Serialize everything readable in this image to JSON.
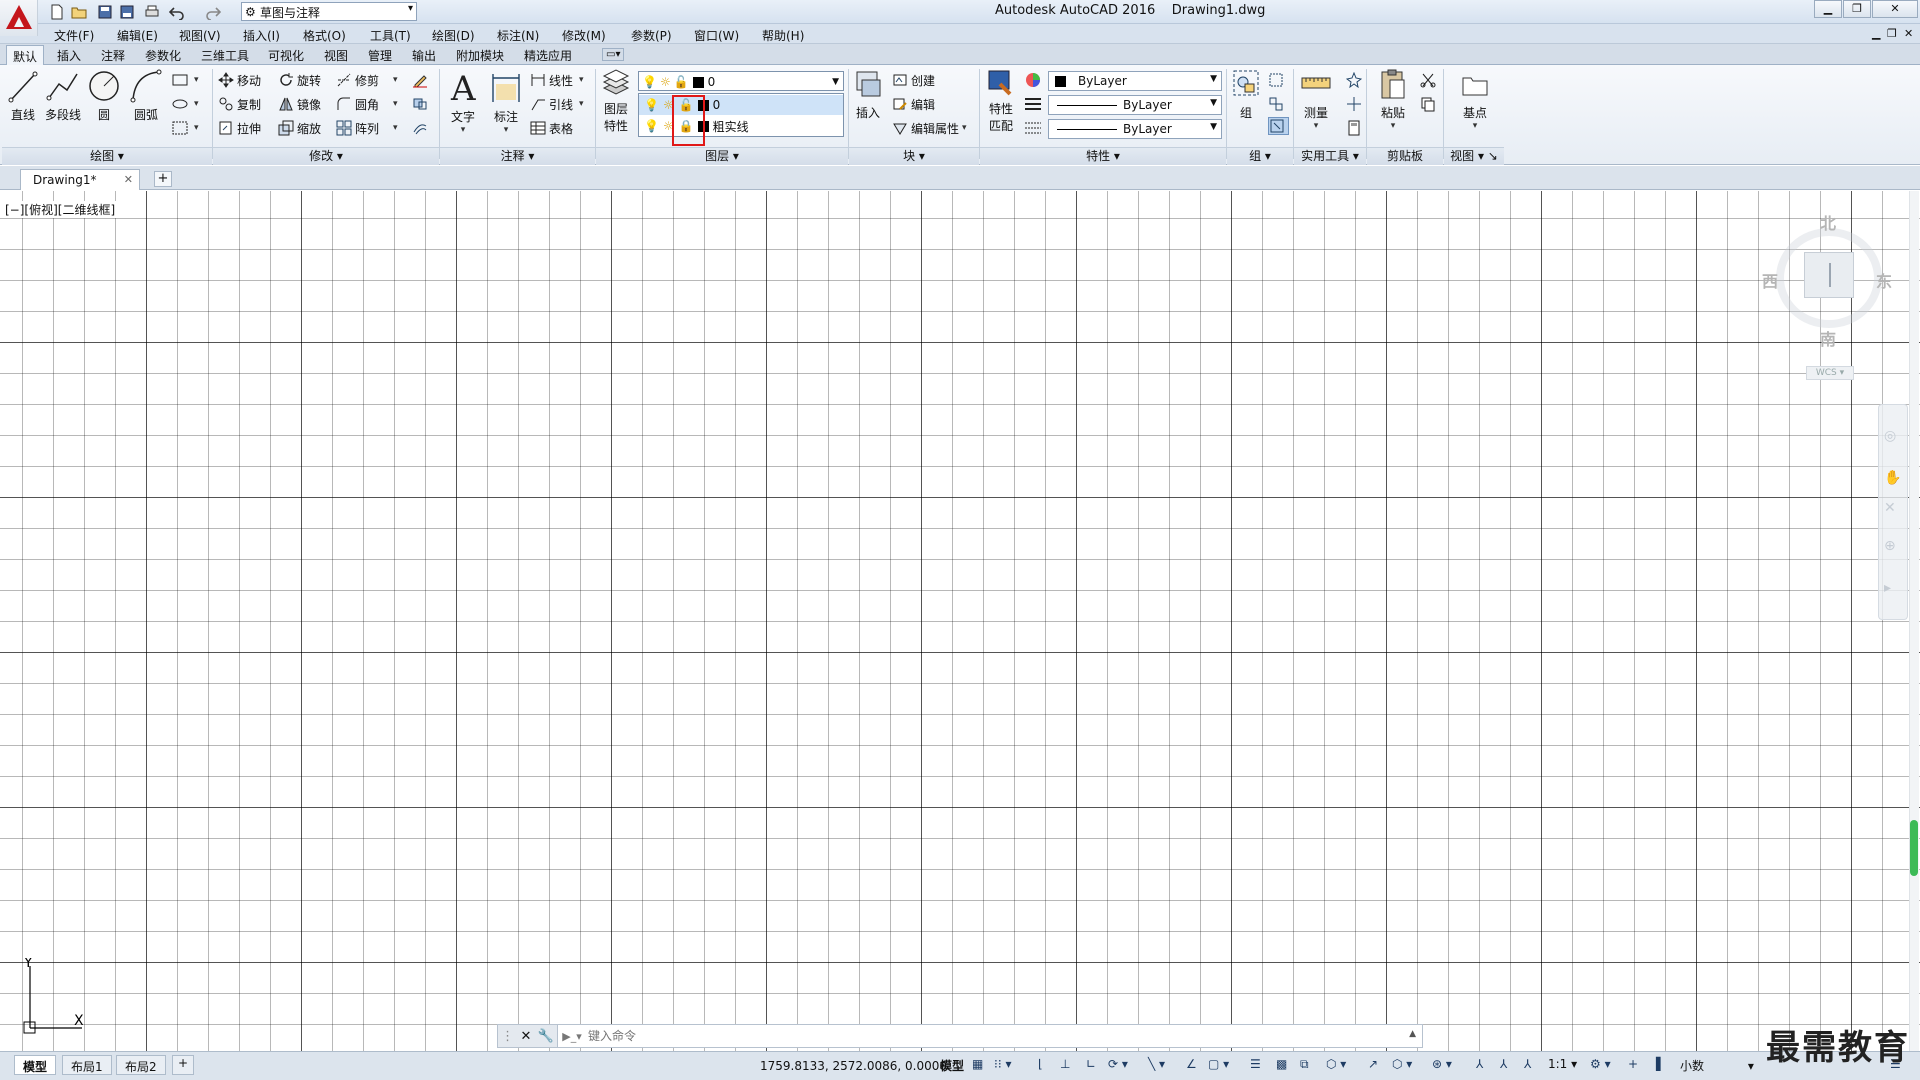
{
  "titlebar": {
    "title": "Autodesk AutoCAD 2016",
    "document": "Drawing1.dwg",
    "workspace": "草图与注释"
  },
  "menu": [
    "文件(F)",
    "编辑(E)",
    "视图(V)",
    "插入(I)",
    "格式(O)",
    "工具(T)",
    "绘图(D)",
    "标注(N)",
    "修改(M)",
    "参数(P)",
    "窗口(W)",
    "帮助(H)"
  ],
  "ribbon_tabs": [
    "默认",
    "插入",
    "注释",
    "参数化",
    "三维工具",
    "可视化",
    "视图",
    "管理",
    "输出",
    "附加模块",
    "精选应用"
  ],
  "ribbon": {
    "draw": {
      "title": "绘图",
      "line": "直线",
      "polyline": "多段线",
      "circle": "圆",
      "arc": "圆弧"
    },
    "modify": {
      "title": "修改",
      "move": "移动",
      "rotate": "旋转",
      "trim": "修剪",
      "copy": "复制",
      "mirror": "镜像",
      "fillet": "圆角",
      "stretch": "拉伸",
      "scale": "缩放",
      "array": "阵列"
    },
    "annotation": {
      "title": "注释",
      "text": "文字",
      "dimension": "标注",
      "linear": "线性",
      "leader": "引线",
      "table": "表格"
    },
    "layers": {
      "title": "图层",
      "properties_line1": "图层",
      "properties_line2": "特性",
      "current": "0",
      "list": [
        {
          "name": "0",
          "locked": false
        },
        {
          "name": "粗实线",
          "locked": true
        }
      ]
    },
    "block": {
      "title": "块",
      "insert": "插入",
      "create": "创建",
      "edit": "编辑",
      "edit_attr": "编辑属性"
    },
    "properties": {
      "title": "特性",
      "match_line1": "特性",
      "match_line2": "匹配",
      "color": "ByLayer",
      "linetype": "ByLayer",
      "lineweight": "ByLayer"
    },
    "groups": {
      "title": "组",
      "group": "组"
    },
    "utilities": {
      "title": "实用工具",
      "measure": "测量"
    },
    "clipboard": {
      "title": "剪贴板",
      "paste": "粘贴"
    },
    "view": {
      "title": "视图",
      "base": "基点"
    }
  },
  "file_tab": {
    "name": "Drawing1*"
  },
  "viewport_label": "[−][俯视][二维线框]",
  "viewcube": {
    "north": "北",
    "south": "南",
    "east": "东",
    "west": "西",
    "wcs": "WCS"
  },
  "ucs": {
    "x": "X",
    "y": "Y"
  },
  "command": {
    "placeholder": "键入命令"
  },
  "layout_tabs": [
    "模型",
    "布局1",
    "布局2"
  ],
  "status": {
    "coords": "1759.8133, 2572.0086, 0.0000",
    "space": "模型",
    "scale": "1:1",
    "units": "小数"
  },
  "watermark": "最需教育"
}
